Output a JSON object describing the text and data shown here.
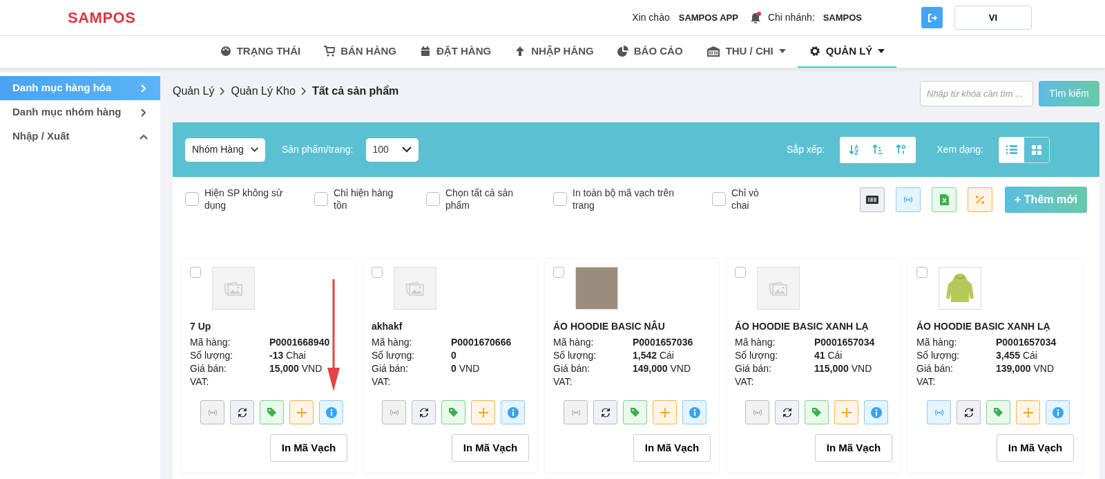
{
  "header": {
    "logo": "SAMPOS",
    "greeting_label": "Xin chào",
    "user": "SAMPOS APP",
    "notification_dot": true,
    "branch_label": "Chi nhánh:",
    "branch": "SAMPOS",
    "language": "VI"
  },
  "nav": [
    {
      "label": "TRẠNG THÁI",
      "has_caret": false,
      "selected": false
    },
    {
      "label": "BÁN HÀNG",
      "has_caret": false,
      "selected": false
    },
    {
      "label": "ĐẶT HÀNG",
      "has_caret": false,
      "selected": false
    },
    {
      "label": "NHẬP HÀNG",
      "has_caret": false,
      "selected": false
    },
    {
      "label": "BÁO CÁO",
      "has_caret": false,
      "selected": false
    },
    {
      "label": "THU / CHI",
      "has_caret": true,
      "selected": false
    },
    {
      "label": "QUẢN LÝ",
      "has_caret": true,
      "selected": true
    }
  ],
  "sidebar": {
    "items": [
      {
        "label": "Danh mục hàng hóa",
        "selected": true,
        "expanded": false
      },
      {
        "label": "Danh mục nhóm hàng",
        "selected": false,
        "expanded": false
      },
      {
        "label": "Nhập / Xuất",
        "selected": false,
        "expanded": true
      }
    ]
  },
  "breadcrumb": [
    "Quản Lý",
    "Quản Lý Kho",
    "Tất cả sản phẩm"
  ],
  "search": {
    "placeholder": "Nhập từ khóa cần tìm ...",
    "button": "Tìm kiếm"
  },
  "toolbar": {
    "group_select": "Nhóm Hàng",
    "per_page_label": "Sản phẩm/trang:",
    "per_page": "100",
    "sort_label": "Sắp xếp:",
    "view_label": "Xem dạng:",
    "views": [
      {
        "kind": "list",
        "selected": false
      },
      {
        "kind": "grid",
        "selected": true
      }
    ]
  },
  "filters": [
    {
      "label": "Hiện SP không sử dụng",
      "checked": false
    },
    {
      "label": "Chỉ hiện hàng tồn",
      "checked": false
    },
    {
      "label": "Chọn tất cả sản phẩm",
      "checked": false
    },
    {
      "label": "In toàn bộ mã vạch trên trang",
      "checked": false
    },
    {
      "label": "Chỉ vỏ chai",
      "checked": false
    }
  ],
  "add_button": "+ Thêm mới",
  "products": [
    {
      "name": "7 Up",
      "kind": "placeholder",
      "checked": false,
      "code_label": "Mã hàng:",
      "code": "P0001668940",
      "qty_label": "Số lượng:",
      "qty": "**-13** Chai",
      "price_label": "Giá bán:",
      "price": "**15,000** VND",
      "vat_label": "VAT:",
      "rfid_active": false,
      "arrow": true,
      "print": "In Mã Vạch"
    },
    {
      "name": "akhakf",
      "kind": "placeholder",
      "checked": false,
      "code_label": "Mã hàng:",
      "code": "P0001670666",
      "qty_label": "Số lượng:",
      "qty": "**0**",
      "price_label": "Giá bán:",
      "price": "**0** VND",
      "vat_label": "VAT:",
      "rfid_active": false,
      "arrow": false,
      "print": "In Mã Vạch"
    },
    {
      "name": "ÁO HOODIE BASIC NÂU",
      "kind": "photo",
      "checked": false,
      "code_label": "Mã hàng:",
      "code": "P0001657036",
      "qty_label": "Số lượng:",
      "qty": "**1,542** Cái",
      "price_label": "Giá bán:",
      "price": "**149,000** VND",
      "vat_label": "VAT:",
      "rfid_active": false,
      "arrow": false,
      "print": "In Mã Vạch"
    },
    {
      "name": "ÁO HOODIE BASIC XANH LẠ",
      "kind": "placeholder",
      "checked": false,
      "code_label": "Mã hàng:",
      "code": "P0001657034",
      "qty_label": "Số lượng:",
      "qty": "**41** Cái",
      "price_label": "Giá bán:",
      "price": "**115,000** VND",
      "vat_label": "VAT:",
      "rfid_active": false,
      "arrow": false,
      "print": "In Mã Vạch"
    },
    {
      "name": "ÁO HOODIE BASIC XANH LẠ",
      "kind": "hoodie",
      "checked": false,
      "code_label": "Mã hàng:",
      "code": "P0001657034",
      "qty_label": "Số lượng:",
      "qty": "**3,455** Cái",
      "price_label": "Giá bán:",
      "price": "**139,000** VND",
      "vat_label": "VAT:",
      "rfid_active": true,
      "arrow": false,
      "print": "In Mã Vạch"
    }
  ]
}
